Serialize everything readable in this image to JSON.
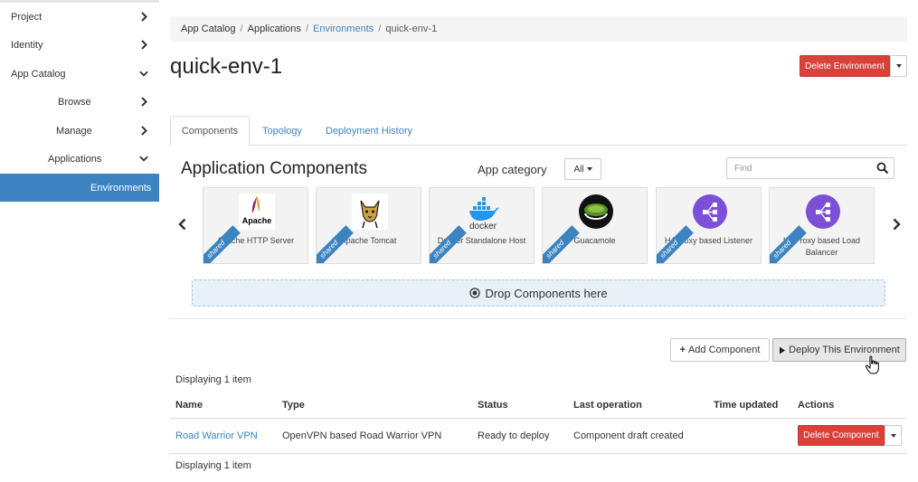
{
  "sidebar": {
    "items": [
      {
        "label": "Project"
      },
      {
        "label": "Identity"
      },
      {
        "label": "App Catalog"
      },
      {
        "label": "Browse"
      },
      {
        "label": "Manage"
      },
      {
        "label": "Applications"
      },
      {
        "label": "Environments"
      }
    ]
  },
  "breadcrumb": [
    "App Catalog",
    "Applications",
    "Environments",
    "quick-env-1"
  ],
  "page_title": "quick-env-1",
  "delete_environment_label": "Delete Environment",
  "tabs": [
    {
      "label": "Components"
    },
    {
      "label": "Topology"
    },
    {
      "label": "Deployment History"
    }
  ],
  "section_title": "Application Components",
  "app_category_label": "App category",
  "app_category_value": "All",
  "find_placeholder": "Find",
  "components": [
    {
      "name": "Apache HTTP Server",
      "badge": "shared",
      "logo": "apache-logo"
    },
    {
      "name": "Apache Tomcat",
      "badge": "shared",
      "logo": "tomcat-logo"
    },
    {
      "name": "Docker Standalone Host",
      "badge": "shared",
      "logo": "docker-logo"
    },
    {
      "name": "Guacamole",
      "badge": "shared",
      "logo": "guacamole-logo"
    },
    {
      "name": "HAProxy based Listener",
      "badge": "shared",
      "logo": "haproxy-logo"
    },
    {
      "name": "HAProxy based Load Balancer",
      "badge": "shared",
      "logo": "haproxy-logo"
    }
  ],
  "logo_text": {
    "apache": "Apache",
    "docker": "docker"
  },
  "drop_zone_label": "Drop Components here",
  "add_component_label": "Add Component",
  "deploy_label": "Deploy This Environment",
  "displaying_top": "Displaying 1 item",
  "displaying_bottom": "Displaying 1 item",
  "table": {
    "headers": [
      "Name",
      "Type",
      "Status",
      "Last operation",
      "Time updated",
      "Actions"
    ],
    "rows": [
      {
        "name": "Road Warrior VPN",
        "type": "OpenVPN based Road Warrior VPN",
        "status": "Ready to deploy",
        "last_operation": "Component draft created",
        "time_updated": "",
        "action": "Delete Component"
      }
    ]
  },
  "colors": {
    "accent": "#3b83c1",
    "danger": "#d9413a",
    "active_nav": "#3b83c1"
  }
}
